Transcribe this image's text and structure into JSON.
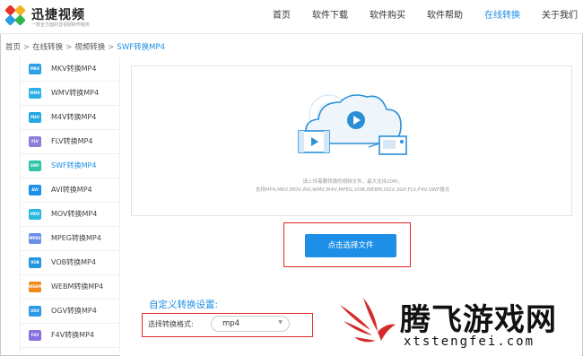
{
  "header": {
    "logo_title": "迅捷视频",
    "logo_sub": "一款全方面的音视频制作服务",
    "nav": [
      {
        "label": "首页",
        "active": false
      },
      {
        "label": "软件下载",
        "active": false
      },
      {
        "label": "软件购买",
        "active": false
      },
      {
        "label": "软件帮助",
        "active": false
      },
      {
        "label": "在线转换",
        "active": true
      },
      {
        "label": "关于我们",
        "active": false
      }
    ]
  },
  "breadcrumb": {
    "items": [
      "首页",
      "在线转换",
      "视频转换"
    ],
    "current": "SWF转换MP4",
    "separator": ">"
  },
  "sidebar": {
    "items": [
      {
        "icon": "MKV",
        "label": "MKV转换MP4",
        "color": "#2aa0e6",
        "active": false
      },
      {
        "icon": "WMV",
        "label": "WMV转换MP4",
        "color": "#2ab0e8",
        "active": false
      },
      {
        "icon": "M4V",
        "label": "M4V转换MP4",
        "color": "#27a8e4",
        "active": false
      },
      {
        "icon": "FLV",
        "label": "FLV转换MP4",
        "color": "#8a7fd6",
        "active": false
      },
      {
        "icon": "SWF",
        "label": "SWF转换MP4",
        "color": "#2fc4a8",
        "active": true
      },
      {
        "icon": "AVI",
        "label": "AVI转换MP4",
        "color": "#1e90e6",
        "active": false
      },
      {
        "icon": "MOV",
        "label": "MOV转换MP4",
        "color": "#2ab8e0",
        "active": false
      },
      {
        "icon": "MPEG",
        "label": "MPEG转换MP4",
        "color": "#6b8ee8",
        "active": false
      },
      {
        "icon": "VOB",
        "label": "VOB转换MP4",
        "color": "#2596e0",
        "active": false
      },
      {
        "icon": "WEBM",
        "label": "WEBM转换MP4",
        "color": "#f08a1e",
        "active": false
      },
      {
        "icon": "OGV",
        "label": "OGV转换MP4",
        "color": "#2a9ae6",
        "active": false
      },
      {
        "icon": "F4V",
        "label": "F4V转换MP4",
        "color": "#8a6fe0",
        "active": false
      }
    ]
  },
  "upload": {
    "hint_line1": "请上传需要转换的视频文件，最大支持20M，",
    "hint_line2": "支持MP4,MKV,MOV,AVI,WMV,M4V,MPEG,VOB,WEBM,OGV,3GP,FLV,F4V,SWF格式",
    "button_label": "点击选择文件"
  },
  "settings": {
    "title": "自定义转换设置:",
    "format_label": "选择转换格式:",
    "format_value": "mp4"
  },
  "watermark": {
    "title": "腾飞游戏网",
    "url": "xtstengfei.com"
  },
  "colors": {
    "accent": "#1e8fe6",
    "highlight_border": "#e02828"
  }
}
